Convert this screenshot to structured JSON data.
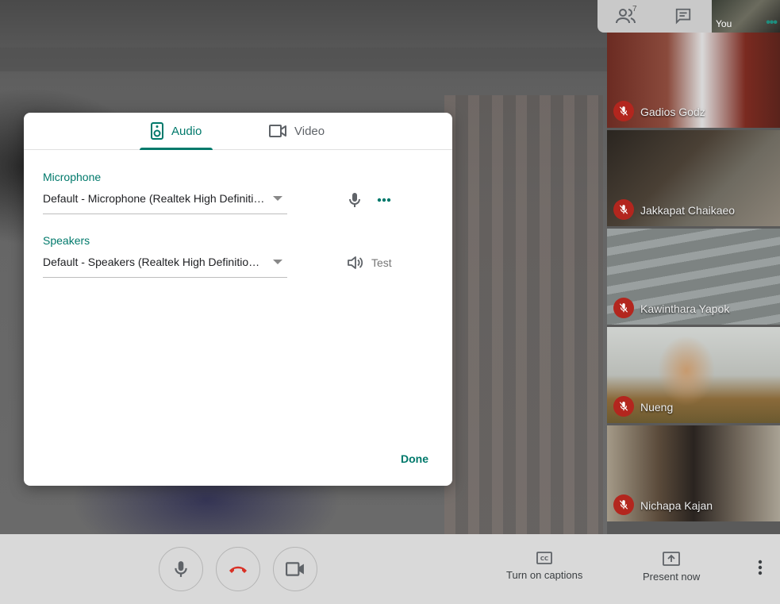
{
  "dialog": {
    "tabs": [
      {
        "label": "Audio",
        "icon": "speaker-device-icon",
        "active": true
      },
      {
        "label": "Video",
        "icon": "video-camera-icon",
        "active": false
      }
    ],
    "microphone": {
      "label": "Microphone",
      "value": "Default - Microphone (Realtek High Definition Audio)"
    },
    "speakers": {
      "label": "Speakers",
      "value": "Default - Speakers (Realtek High Definition Audio)",
      "test_label": "Test"
    },
    "done_label": "Done"
  },
  "top_panel": {
    "participant_count": "7",
    "self_label": "You"
  },
  "participants": [
    {
      "name": "Gadios Godz"
    },
    {
      "name": "Jakkapat Chaikaeo"
    },
    {
      "name": "Kawinthara Yapok"
    },
    {
      "name": "Nueng"
    },
    {
      "name": "Nichapa Kajan"
    }
  ],
  "bottom_bar": {
    "captions_label": "Turn on captions",
    "present_label": "Present now"
  },
  "colors": {
    "accent": "#00796b",
    "hangup": "#d93025",
    "mute_badge": "#b3261e"
  }
}
